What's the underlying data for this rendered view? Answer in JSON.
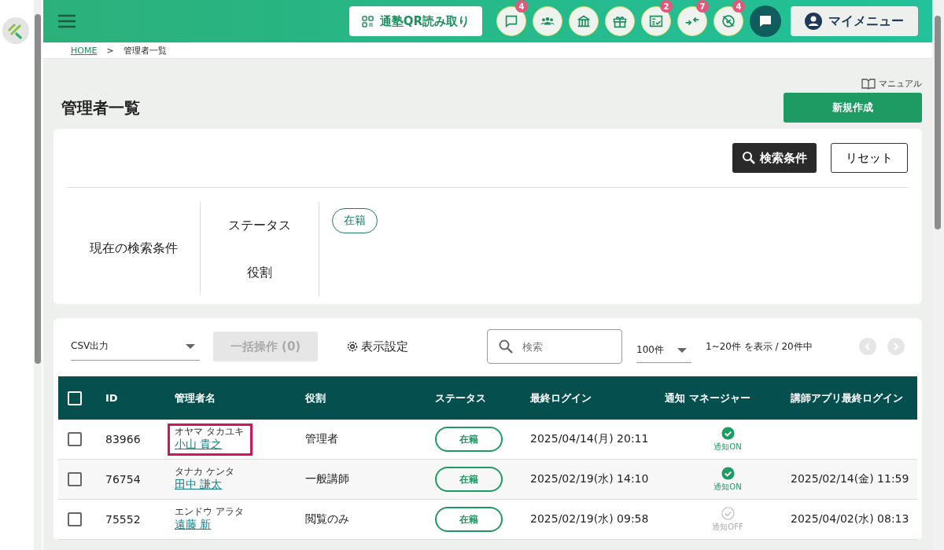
{
  "header": {
    "qr_button": "通塾QR読み取り",
    "icon_buttons": [
      {
        "kind": "chat",
        "badge": "4"
      },
      {
        "kind": "people"
      },
      {
        "kind": "building"
      },
      {
        "kind": "gift"
      },
      {
        "kind": "checklist",
        "badge": "2"
      },
      {
        "kind": "arrows",
        "badge": "7"
      },
      {
        "kind": "blocked",
        "badge": "4"
      }
    ],
    "my_menu": "マイメニュー"
  },
  "breadcrumb": {
    "home": "HOME",
    "separator": ">",
    "current": "管理者一覧"
  },
  "manual_link": "マニュアル",
  "page_title": "管理者一覧",
  "create_button": "新規作成",
  "search_panel": {
    "search_button": "検索条件",
    "reset_button": "リセット",
    "current_label": "現在の検索条件",
    "conditions": [
      {
        "label": "ステータス",
        "chips": [
          "在籍"
        ]
      },
      {
        "label": "役割"
      }
    ]
  },
  "toolbar": {
    "csv_select": "CSV出力",
    "bulk_button": {
      "label": "一括操作 (0)",
      "disabled": true
    },
    "display_settings": "表示設定",
    "search": {
      "placeholder": "検索"
    },
    "page_size": "100件",
    "range": "1~20件 を表示 / 20件中"
  },
  "table": {
    "all_checked": false,
    "columns": [
      "ID",
      "管理者名",
      "役割",
      "ステータス",
      "最終ログイン",
      "通知 マネージャー",
      "講師アプリ最終ログイン"
    ],
    "rows": [
      {
        "checked": false,
        "id": "83966",
        "kana": "オヤマ タカユキ",
        "name": "小山 貴之",
        "highlighted": true,
        "role": "管理者",
        "status": "在籍",
        "last_login": "2025/04/14(月) 20:11",
        "notify_on": true,
        "notify_label": "通知ON"
      },
      {
        "checked": false,
        "id": "76754",
        "kana": "タナカ ケンタ",
        "name": "田中 謙太",
        "highlighted": false,
        "role": "一般講師",
        "status": "在籍",
        "last_login": "2025/02/19(水) 14:10",
        "notify_on": true,
        "notify_label": "通知ON",
        "app_login": "2025/02/14(金) 11:59"
      },
      {
        "checked": false,
        "id": "75552",
        "kana": "エンドウ アラタ",
        "name": "遠藤 新",
        "highlighted": false,
        "role": "閲覧のみ",
        "status": "在籍",
        "last_login": "2025/02/19(水) 09:58",
        "notify_on": false,
        "notify_label": "通知OFF",
        "app_login": "2025/04/02(水) 08:13"
      }
    ]
  }
}
